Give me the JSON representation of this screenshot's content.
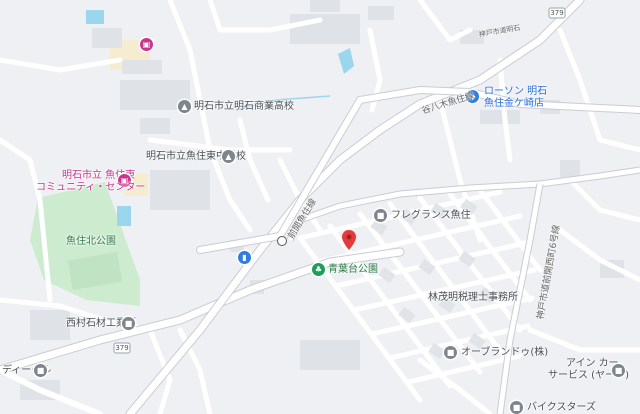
{
  "map": {
    "labels": {
      "high_school": "明石市立明石商業高校",
      "junior_high": "明石市立魚住東中学校",
      "community_center_1": "明石市立 魚住東",
      "community_center_2": "コミュニティ・センター",
      "park_north": "魚住北公園",
      "nishimura": "西村石材工業所",
      "deale": "ディーール",
      "lawson_1": "ローソン 明石",
      "lawson_2": "魚住金ケ崎店",
      "fragrance": "フレグランス魚住",
      "aobadai_park": "青葉台公園",
      "hayashi": "林茂明税理士事務所",
      "oburando": "オーブランドゥ(株)",
      "ain_1": "アイン カー",
      "ain_2": "サービス (ヤード)",
      "bikes": "バイクスターズ",
      "road_taniyahagi": "谷八木魚住線",
      "road_nishi_nakamura": "前開魚住線",
      "road_kobe_1": "神戸市道明石",
      "road_kobe_2": "神戸市道前開西町6号線",
      "route_379a": "379",
      "route_379b": "379"
    },
    "colors": {
      "background": "#eef0f3",
      "road": "#ffffff",
      "arterial": "#c8ccd4",
      "park": "#cdeccf",
      "water": "#9ad6ec",
      "building": "#dfe2e7",
      "selected_pin": "#e23b3b"
    },
    "icons": {
      "school": "school-icon",
      "park": "park-icon",
      "shop": "shopping-icon",
      "selected": "location-pin-icon"
    }
  }
}
